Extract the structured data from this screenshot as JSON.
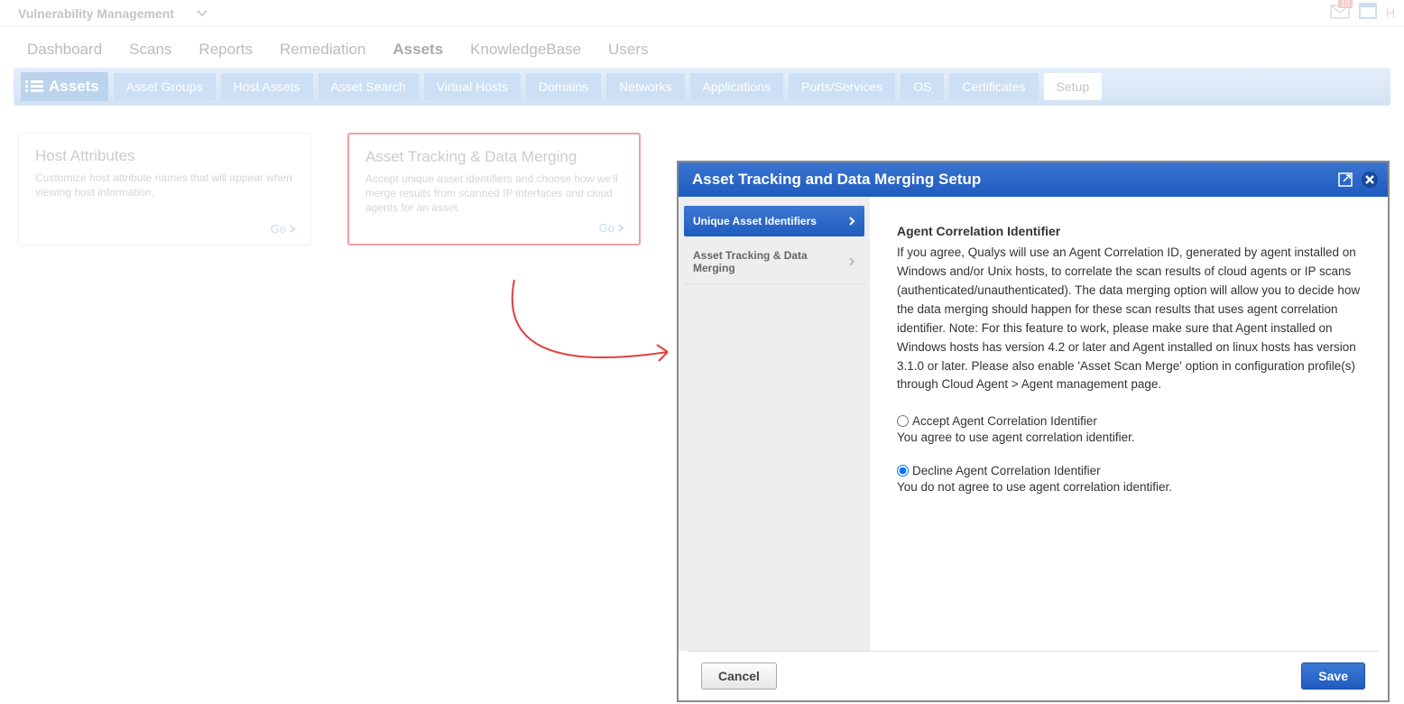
{
  "top": {
    "module": "Vulnerability Management",
    "mail_badge": "10",
    "help_initial": "H"
  },
  "mainnav": {
    "items": [
      "Dashboard",
      "Scans",
      "Reports",
      "Remediation",
      "Assets",
      "KnowledgeBase",
      "Users"
    ],
    "active": "Assets"
  },
  "tabstrip": {
    "section": "Assets",
    "tabs": [
      "Asset Groups",
      "Host Assets",
      "Asset Search",
      "Virtual Hosts",
      "Domains",
      "Networks",
      "Applications",
      "Ports/Services",
      "OS",
      "Certificates",
      "Setup"
    ],
    "selected": "Setup"
  },
  "cards": {
    "host_attributes": {
      "title": "Host Attributes",
      "desc": "Customize host attribute names that will appear when viewing host information.",
      "go": "Go"
    },
    "asset_tracking": {
      "title": "Asset Tracking & Data Merging",
      "desc": "Accept unique asset identifiers and choose how we'll merge results from scanned IP interfaces and cloud agents for an asset.",
      "go": "Go"
    }
  },
  "modal": {
    "title": "Asset Tracking and Data Merging Setup",
    "side": {
      "unique": "Unique Asset Identifiers",
      "tracking": "Asset Tracking & Data Merging"
    },
    "heading": "Agent Correlation Identifier",
    "body": "If you agree, Qualys will use an Agent Correlation ID, generated by agent installed on Windows and/or Unix hosts, to correlate the scan results of cloud agents or IP scans (authenticated/unauthenticated). The data merging option will allow you to decide how the data merging should happen for these scan results that uses agent correlation identifier. Note: For this feature to work, please make sure that Agent installed on Windows hosts has version 4.2 or later and Agent installed on linux hosts has version 3.1.0 or later. Please also enable 'Asset Scan Merge' option in configuration profile(s) through Cloud Agent > Agent management page.",
    "accept_label": "Accept Agent Correlation Identifier",
    "accept_desc": "You agree to use agent correlation identifier.",
    "decline_label": "Decline Agent Correlation Identifier",
    "decline_desc": "You do not agree to use agent correlation identifier.",
    "cancel": "Cancel",
    "save": "Save"
  }
}
